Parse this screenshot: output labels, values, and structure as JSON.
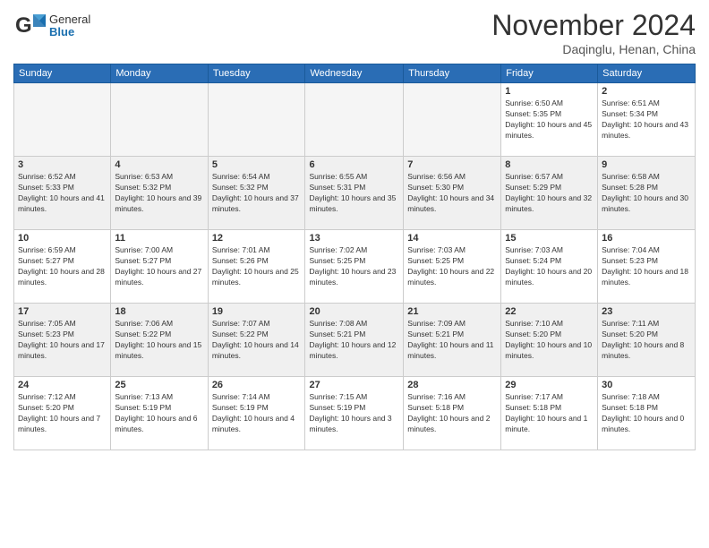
{
  "header": {
    "logo": {
      "general": "General",
      "blue": "Blue"
    },
    "title": "November 2024",
    "location": "Daqinglu, Henan, China"
  },
  "calendar": {
    "days_of_week": [
      "Sunday",
      "Monday",
      "Tuesday",
      "Wednesday",
      "Thursday",
      "Friday",
      "Saturday"
    ],
    "weeks": [
      [
        {
          "day": "",
          "empty": true
        },
        {
          "day": "",
          "empty": true
        },
        {
          "day": "",
          "empty": true
        },
        {
          "day": "",
          "empty": true
        },
        {
          "day": "",
          "empty": true
        },
        {
          "day": "1",
          "sunrise": "Sunrise: 6:50 AM",
          "sunset": "Sunset: 5:35 PM",
          "daylight": "Daylight: 10 hours and 45 minutes."
        },
        {
          "day": "2",
          "sunrise": "Sunrise: 6:51 AM",
          "sunset": "Sunset: 5:34 PM",
          "daylight": "Daylight: 10 hours and 43 minutes."
        }
      ],
      [
        {
          "day": "3",
          "sunrise": "Sunrise: 6:52 AM",
          "sunset": "Sunset: 5:33 PM",
          "daylight": "Daylight: 10 hours and 41 minutes."
        },
        {
          "day": "4",
          "sunrise": "Sunrise: 6:53 AM",
          "sunset": "Sunset: 5:32 PM",
          "daylight": "Daylight: 10 hours and 39 minutes."
        },
        {
          "day": "5",
          "sunrise": "Sunrise: 6:54 AM",
          "sunset": "Sunset: 5:32 PM",
          "daylight": "Daylight: 10 hours and 37 minutes."
        },
        {
          "day": "6",
          "sunrise": "Sunrise: 6:55 AM",
          "sunset": "Sunset: 5:31 PM",
          "daylight": "Daylight: 10 hours and 35 minutes."
        },
        {
          "day": "7",
          "sunrise": "Sunrise: 6:56 AM",
          "sunset": "Sunset: 5:30 PM",
          "daylight": "Daylight: 10 hours and 34 minutes."
        },
        {
          "day": "8",
          "sunrise": "Sunrise: 6:57 AM",
          "sunset": "Sunset: 5:29 PM",
          "daylight": "Daylight: 10 hours and 32 minutes."
        },
        {
          "day": "9",
          "sunrise": "Sunrise: 6:58 AM",
          "sunset": "Sunset: 5:28 PM",
          "daylight": "Daylight: 10 hours and 30 minutes."
        }
      ],
      [
        {
          "day": "10",
          "sunrise": "Sunrise: 6:59 AM",
          "sunset": "Sunset: 5:27 PM",
          "daylight": "Daylight: 10 hours and 28 minutes."
        },
        {
          "day": "11",
          "sunrise": "Sunrise: 7:00 AM",
          "sunset": "Sunset: 5:27 PM",
          "daylight": "Daylight: 10 hours and 27 minutes."
        },
        {
          "day": "12",
          "sunrise": "Sunrise: 7:01 AM",
          "sunset": "Sunset: 5:26 PM",
          "daylight": "Daylight: 10 hours and 25 minutes."
        },
        {
          "day": "13",
          "sunrise": "Sunrise: 7:02 AM",
          "sunset": "Sunset: 5:25 PM",
          "daylight": "Daylight: 10 hours and 23 minutes."
        },
        {
          "day": "14",
          "sunrise": "Sunrise: 7:03 AM",
          "sunset": "Sunset: 5:25 PM",
          "daylight": "Daylight: 10 hours and 22 minutes."
        },
        {
          "day": "15",
          "sunrise": "Sunrise: 7:03 AM",
          "sunset": "Sunset: 5:24 PM",
          "daylight": "Daylight: 10 hours and 20 minutes."
        },
        {
          "day": "16",
          "sunrise": "Sunrise: 7:04 AM",
          "sunset": "Sunset: 5:23 PM",
          "daylight": "Daylight: 10 hours and 18 minutes."
        }
      ],
      [
        {
          "day": "17",
          "sunrise": "Sunrise: 7:05 AM",
          "sunset": "Sunset: 5:23 PM",
          "daylight": "Daylight: 10 hours and 17 minutes."
        },
        {
          "day": "18",
          "sunrise": "Sunrise: 7:06 AM",
          "sunset": "Sunset: 5:22 PM",
          "daylight": "Daylight: 10 hours and 15 minutes."
        },
        {
          "day": "19",
          "sunrise": "Sunrise: 7:07 AM",
          "sunset": "Sunset: 5:22 PM",
          "daylight": "Daylight: 10 hours and 14 minutes."
        },
        {
          "day": "20",
          "sunrise": "Sunrise: 7:08 AM",
          "sunset": "Sunset: 5:21 PM",
          "daylight": "Daylight: 10 hours and 12 minutes."
        },
        {
          "day": "21",
          "sunrise": "Sunrise: 7:09 AM",
          "sunset": "Sunset: 5:21 PM",
          "daylight": "Daylight: 10 hours and 11 minutes."
        },
        {
          "day": "22",
          "sunrise": "Sunrise: 7:10 AM",
          "sunset": "Sunset: 5:20 PM",
          "daylight": "Daylight: 10 hours and 10 minutes."
        },
        {
          "day": "23",
          "sunrise": "Sunrise: 7:11 AM",
          "sunset": "Sunset: 5:20 PM",
          "daylight": "Daylight: 10 hours and 8 minutes."
        }
      ],
      [
        {
          "day": "24",
          "sunrise": "Sunrise: 7:12 AM",
          "sunset": "Sunset: 5:20 PM",
          "daylight": "Daylight: 10 hours and 7 minutes."
        },
        {
          "day": "25",
          "sunrise": "Sunrise: 7:13 AM",
          "sunset": "Sunset: 5:19 PM",
          "daylight": "Daylight: 10 hours and 6 minutes."
        },
        {
          "day": "26",
          "sunrise": "Sunrise: 7:14 AM",
          "sunset": "Sunset: 5:19 PM",
          "daylight": "Daylight: 10 hours and 4 minutes."
        },
        {
          "day": "27",
          "sunrise": "Sunrise: 7:15 AM",
          "sunset": "Sunset: 5:19 PM",
          "daylight": "Daylight: 10 hours and 3 minutes."
        },
        {
          "day": "28",
          "sunrise": "Sunrise: 7:16 AM",
          "sunset": "Sunset: 5:18 PM",
          "daylight": "Daylight: 10 hours and 2 minutes."
        },
        {
          "day": "29",
          "sunrise": "Sunrise: 7:17 AM",
          "sunset": "Sunset: 5:18 PM",
          "daylight": "Daylight: 10 hours and 1 minute."
        },
        {
          "day": "30",
          "sunrise": "Sunrise: 7:18 AM",
          "sunset": "Sunset: 5:18 PM",
          "daylight": "Daylight: 10 hours and 0 minutes."
        }
      ]
    ]
  }
}
